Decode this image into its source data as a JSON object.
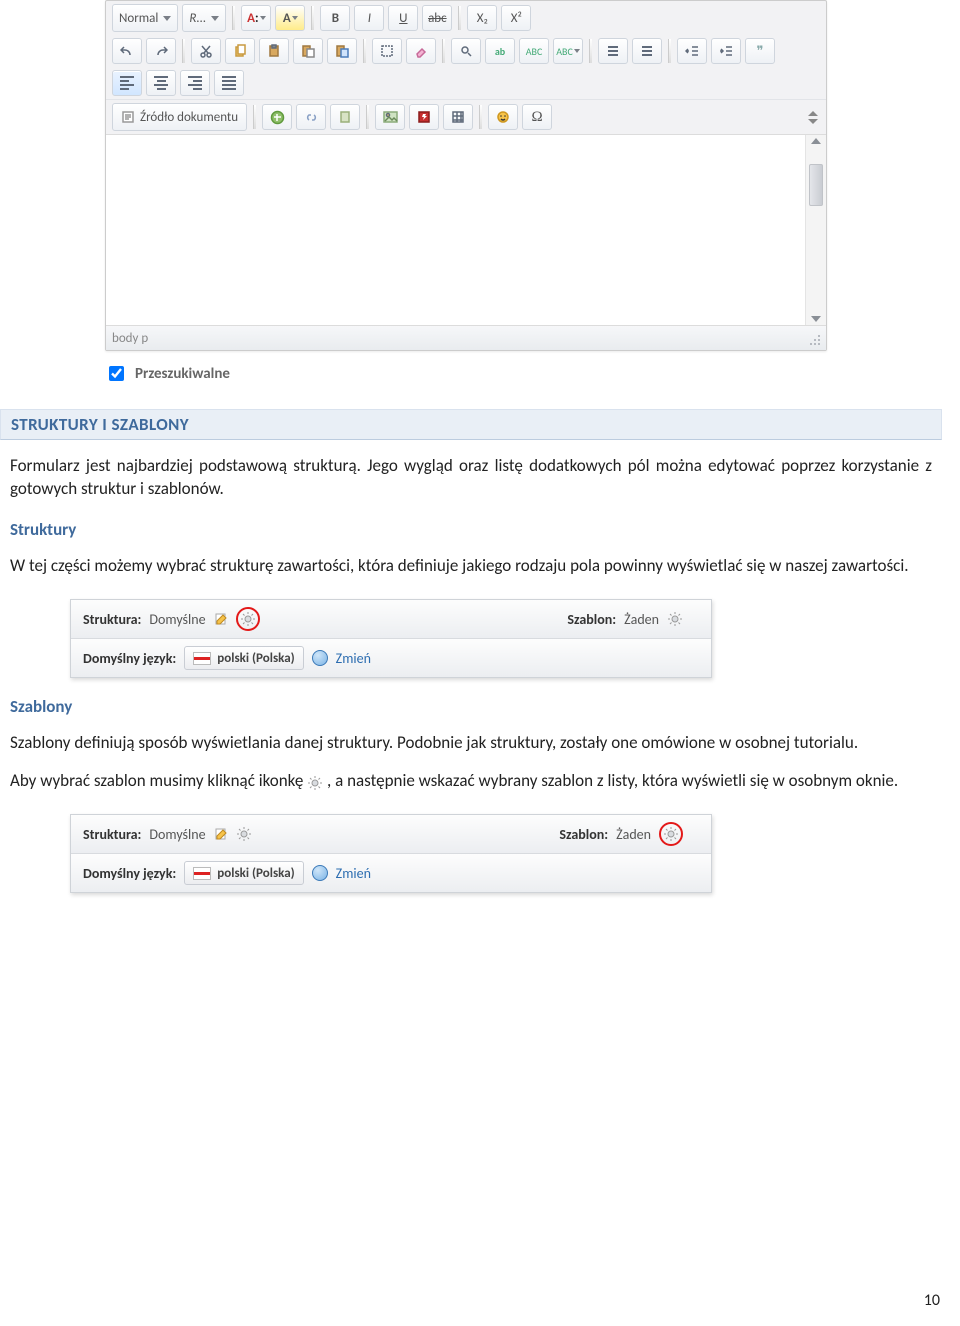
{
  "editor": {
    "format_select": "Normal",
    "font_select": "R...",
    "source_label": "Źródło dokumentu",
    "status_path": "body p",
    "icons": {
      "bold": "B",
      "italic": "I",
      "underline": "U",
      "strike": "abc",
      "sub": "X₂",
      "sup": "X²",
      "quote": "❞"
    }
  },
  "searchable_label": "Przeszukiwalne",
  "heading": "STRUKTURY I SZABLONY",
  "para1": "Formularz jest najbardziej podstawową strukturą. Jego wygląd oraz listę dodatkowych pól można edytować poprzez korzystanie z gotowych struktur i szablonów.",
  "sub_struktury": "Struktury",
  "para2": "W tej części możemy wybrać strukturę zawartości, która definiuje jakiego rodzaju pola powinny wyświetlać się w naszej zawartości.",
  "panel": {
    "struktura_label": "Struktura:",
    "struktura_value": "Domyślne",
    "szablon_label": "Szablon:",
    "szablon_value": "Żaden",
    "lang_label": "Domyślny język:",
    "lang_value": "polski (Polska)",
    "change": "Zmień"
  },
  "sub_szablony": "Szablony",
  "para3": "Szablony definiują sposób wyświetlania danej struktury. Podobnie jak struktury, zostały one omówione w osobnej tutorialu.",
  "para4a": "Aby wybrać szablon musimy kliknąć ikonkę ",
  "para4b": ", a następnie wskazać wybrany szablon z listy, która wyświetli się w osobnym oknie.",
  "panel2": {
    "szablon_value": "Żaden"
  },
  "page_number": "10"
}
